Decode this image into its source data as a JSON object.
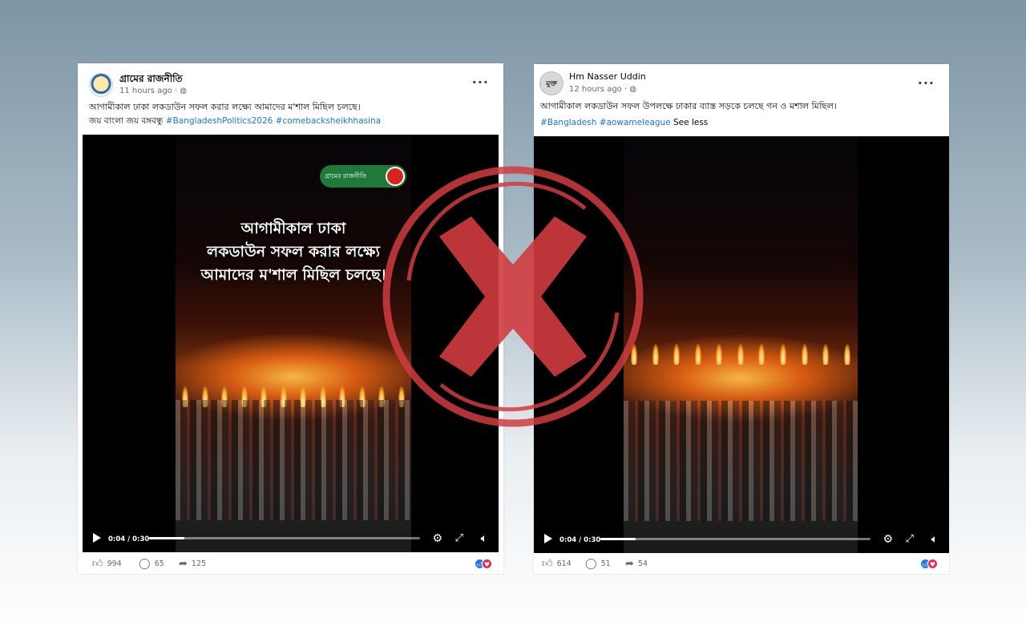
{
  "post1": {
    "author": "গ্রামের রাজনীতি",
    "time": "11 hours ago",
    "time_sep": " · ",
    "caption": "আগামীকাল ঢাকা লকডাউন সফল করার লক্ষ্যে আমাদের ম'শাল মিছিল চলছে।",
    "hashtag_prefix": "জয় বাংলা জয় বঙ্গবন্ধু",
    "tags": [
      "#BangladeshPolitics2026",
      "#comebacksheikhhasina"
    ],
    "video": {
      "overlay_lines": [
        "আগামীকাল ঢাকা",
        "লকডাউন সফল করার লক্ষ্যে",
        "আমাদের ম'শাল মিছিল চলছে।"
      ],
      "logo_text": "গ্রামের রাজনীতি",
      "time": "0:04 / 0:30",
      "progress": 0.13
    },
    "stats": {
      "likes": "994",
      "comments": "65",
      "shares": "125"
    }
  },
  "post2": {
    "author": "Hm Nasser Uddin",
    "avatar_text": "মুক্ত",
    "time": "12 hours ago",
    "time_sep": " · ",
    "caption": "আগামীকাল লকডাউন সফল উপলক্ষে ঢাকার ব্যাস্ত সড়কে চলছে গন ও মশাল মিছিল।",
    "tags": [
      "#Bangladesh",
      "#aowameleague"
    ],
    "see_less": "See less",
    "video": {
      "time": "0:04 / 0:30",
      "progress": 0.13
    },
    "stats": {
      "likes": "614",
      "comments": "51",
      "shares": "54"
    }
  },
  "icons": {
    "like": "thumbs-up-icon",
    "comment": "comment-icon",
    "share": "share-icon",
    "more": "more-options-icon",
    "globe": "globe-icon",
    "settings": "gear-icon",
    "fullscreen": "expand-icon",
    "volume": "volume-icon"
  },
  "colors": {
    "link": "#1b74e4",
    "x_mark": "#d03c3f",
    "like_badge": "#1877f2",
    "love_badge": "#f02849"
  }
}
